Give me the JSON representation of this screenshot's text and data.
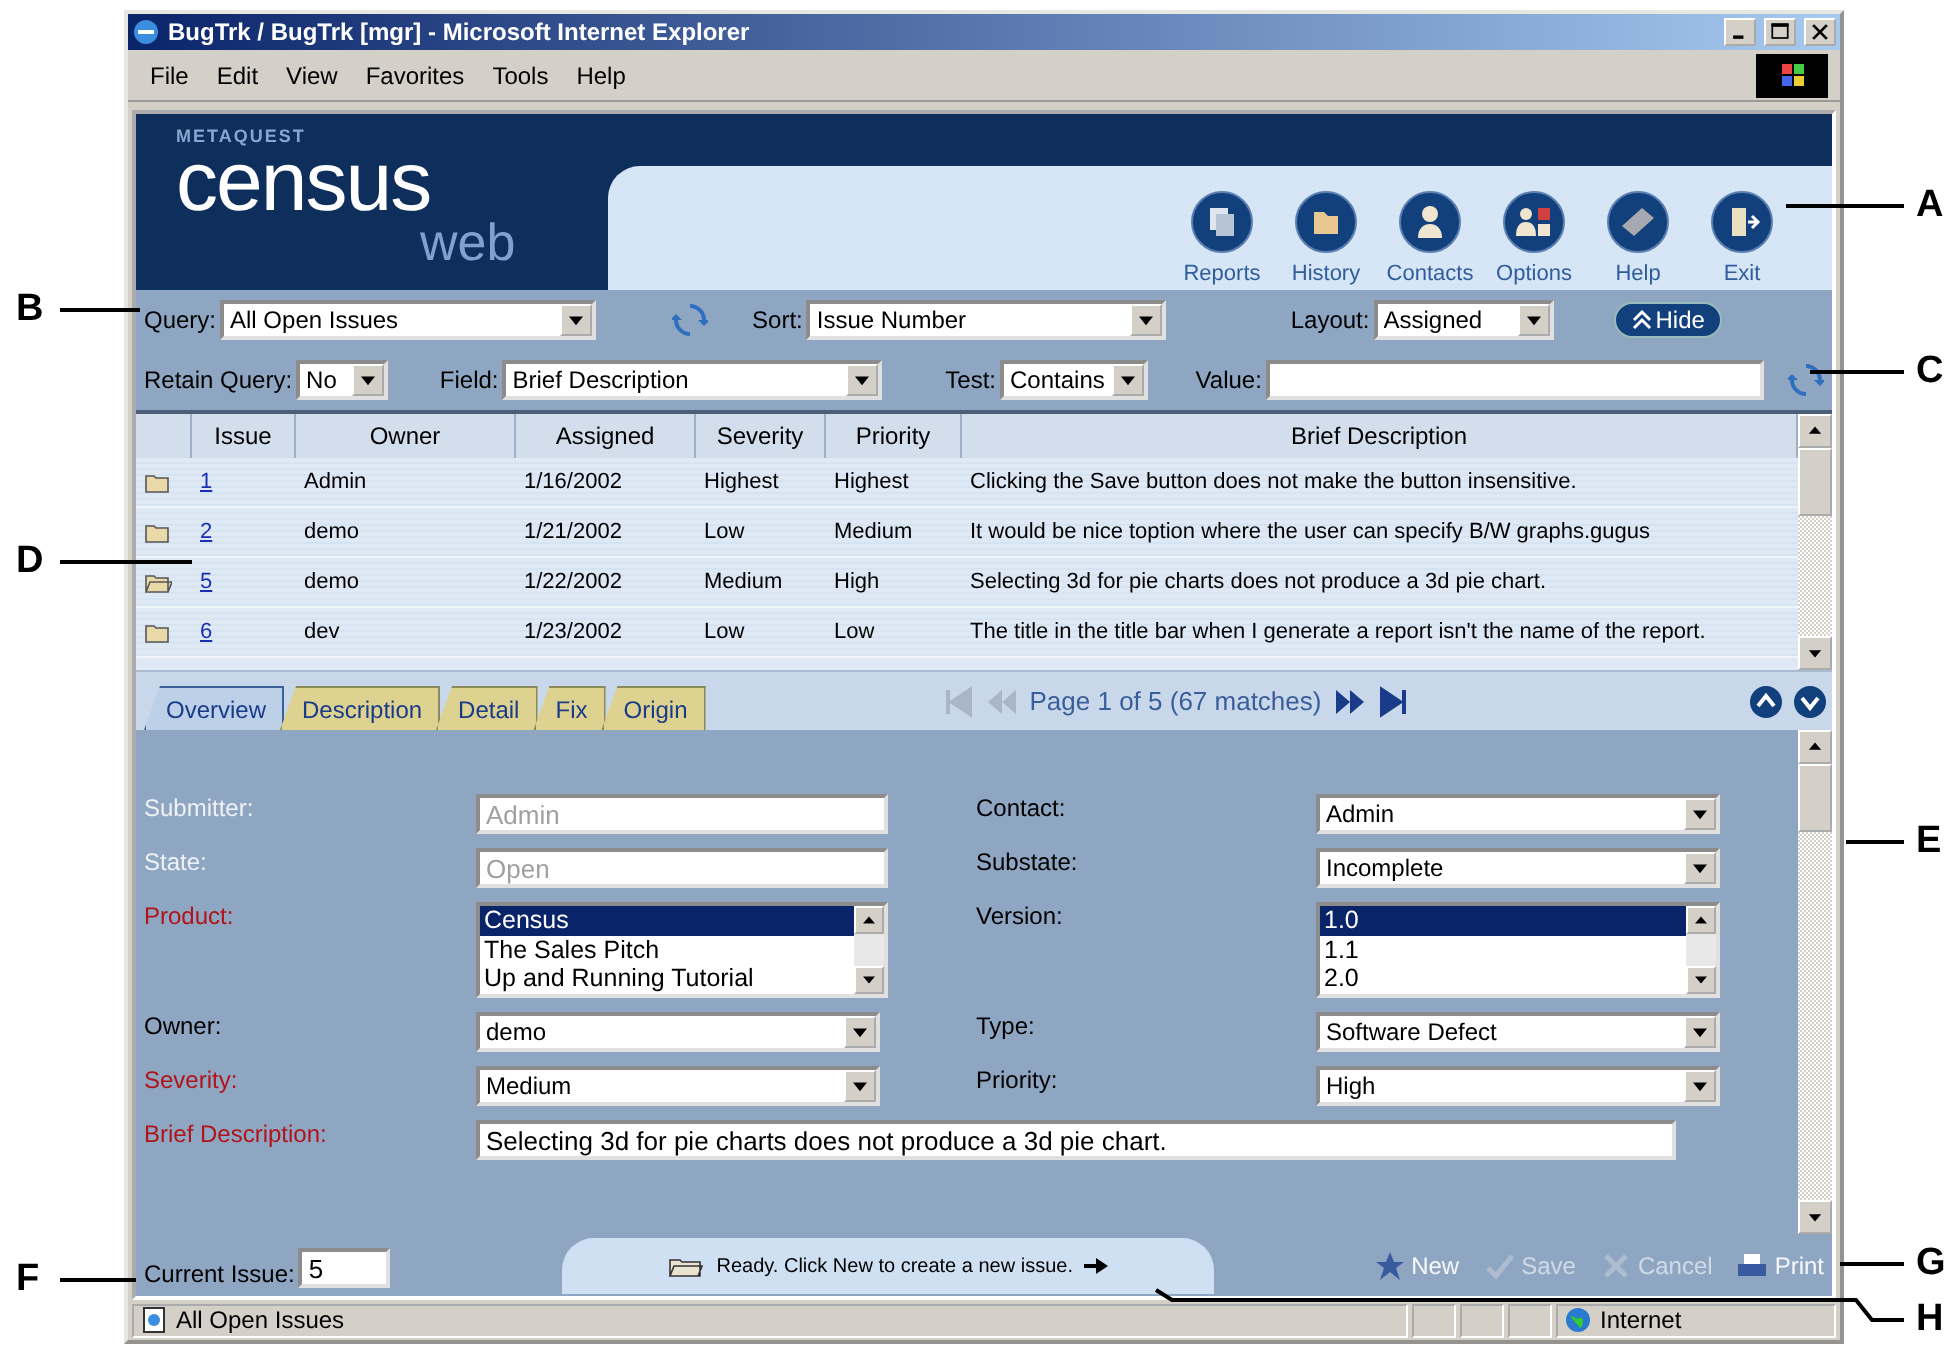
{
  "window": {
    "title": "BugTrk / BugTrk [mgr] - Microsoft Internet Explorer"
  },
  "menu": [
    "File",
    "Edit",
    "View",
    "Favorites",
    "Tools",
    "Help"
  ],
  "logo": {
    "brand": "METAQUEST",
    "name": "census",
    "sub": "web"
  },
  "nav": [
    {
      "label": "Reports",
      "kind": "reports"
    },
    {
      "label": "History",
      "kind": "history"
    },
    {
      "label": "Contacts",
      "kind": "contacts"
    },
    {
      "label": "Options",
      "kind": "options"
    },
    {
      "label": "Help",
      "kind": "help"
    },
    {
      "label": "Exit",
      "kind": "exit"
    }
  ],
  "query": {
    "query_label": "Query:",
    "query_value": "All Open Issues",
    "sort_label": "Sort:",
    "sort_value": "Issue Number",
    "layout_label": "Layout:",
    "layout_value": "Assigned",
    "hide": "Hide",
    "retain_label": "Retain Query:",
    "retain_value": "No",
    "field_label": "Field:",
    "field_value": "Brief Description",
    "test_label": "Test:",
    "test_value": "Contains",
    "value_label": "Value:"
  },
  "table": {
    "columns": [
      "Issue",
      "Owner",
      "Assigned",
      "Severity",
      "Priority",
      "Brief Description"
    ],
    "rows": [
      {
        "issue": "1",
        "owner": "Admin",
        "assigned": "1/16/2002",
        "severity": "Highest",
        "priority": "Highest",
        "description": "Clicking the Save button does not make the button insensitive.",
        "selected": false
      },
      {
        "issue": "2",
        "owner": "demo",
        "assigned": "1/21/2002",
        "severity": "Low",
        "priority": "Medium",
        "description": "It would be nice toption where the user can specify B/W graphs.gugus",
        "selected": false
      },
      {
        "issue": "5",
        "owner": "demo",
        "assigned": "1/22/2002",
        "severity": "Medium",
        "priority": "High",
        "description": "Selecting 3d for pie charts does not produce a 3d pie chart.",
        "selected": true
      },
      {
        "issue": "6",
        "owner": "dev",
        "assigned": "1/23/2002",
        "severity": "Low",
        "priority": "Low",
        "description": "The title in the title bar when I generate a report isn't the name of the report.",
        "selected": false
      }
    ]
  },
  "tabs": [
    {
      "label": "Overview",
      "selected": true
    },
    {
      "label": "Description",
      "selected": false
    },
    {
      "label": "Detail",
      "selected": false
    },
    {
      "label": "Fix",
      "selected": false
    },
    {
      "label": "Origin",
      "selected": false
    }
  ],
  "pager": {
    "text": "Page 1 of 5 (67 matches)"
  },
  "form": {
    "rows": [
      [
        {
          "label": "Submitter:",
          "kind": "text",
          "value": "Admin",
          "required": false,
          "disabled": true
        },
        {
          "label": "Contact:",
          "kind": "select",
          "value": "Admin",
          "required": false,
          "disabled": false
        }
      ],
      [
        {
          "label": "State:",
          "kind": "text",
          "value": "Open",
          "required": false,
          "disabled": true
        },
        {
          "label": "Substate:",
          "kind": "select",
          "value": "Incomplete",
          "required": false,
          "disabled": false
        }
      ],
      [
        {
          "label": "Product:",
          "kind": "list",
          "options": [
            {
              "text": "Census",
              "selected": true
            },
            {
              "text": "The Sales Pitch",
              "selected": false
            },
            {
              "text": "Up and Running Tutorial",
              "selected": false
            }
          ],
          "required": true,
          "disabled": false
        },
        {
          "label": "Version:",
          "kind": "list",
          "options": [
            {
              "text": "1.0",
              "selected": true
            },
            {
              "text": "1.1",
              "selected": false
            },
            {
              "text": "2.0",
              "selected": false
            }
          ],
          "required": false,
          "disabled": false
        }
      ],
      [
        {
          "label": "Owner:",
          "kind": "select",
          "value": "demo",
          "required": false,
          "disabled": false
        },
        {
          "label": "Type:",
          "kind": "select",
          "value": "Software Defect",
          "required": false,
          "disabled": false
        }
      ],
      [
        {
          "label": "Severity:",
          "kind": "select",
          "value": "Medium",
          "required": true,
          "disabled": false
        },
        {
          "label": "Priority:",
          "kind": "select",
          "value": "High",
          "required": false,
          "disabled": false
        }
      ]
    ],
    "description": {
      "label": "Brief Description:",
      "value": "Selecting 3d for pie charts does not produce a 3d pie chart.",
      "required": true
    }
  },
  "current_issue": {
    "label": "Current Issue:",
    "value": "5"
  },
  "status_message": "Ready. Click New to create a new issue.",
  "actions": [
    {
      "label": "New",
      "kind": "new",
      "disabled": false
    },
    {
      "label": "Save",
      "kind": "save",
      "disabled": true
    },
    {
      "label": "Cancel",
      "kind": "cancel",
      "disabled": true
    },
    {
      "label": "Print",
      "kind": "print",
      "disabled": false
    }
  ],
  "status_bar": {
    "text": "All Open Issues",
    "zone": "Internet"
  },
  "callouts": [
    "A",
    "B",
    "C",
    "D",
    "E",
    "F",
    "G",
    "H"
  ]
}
